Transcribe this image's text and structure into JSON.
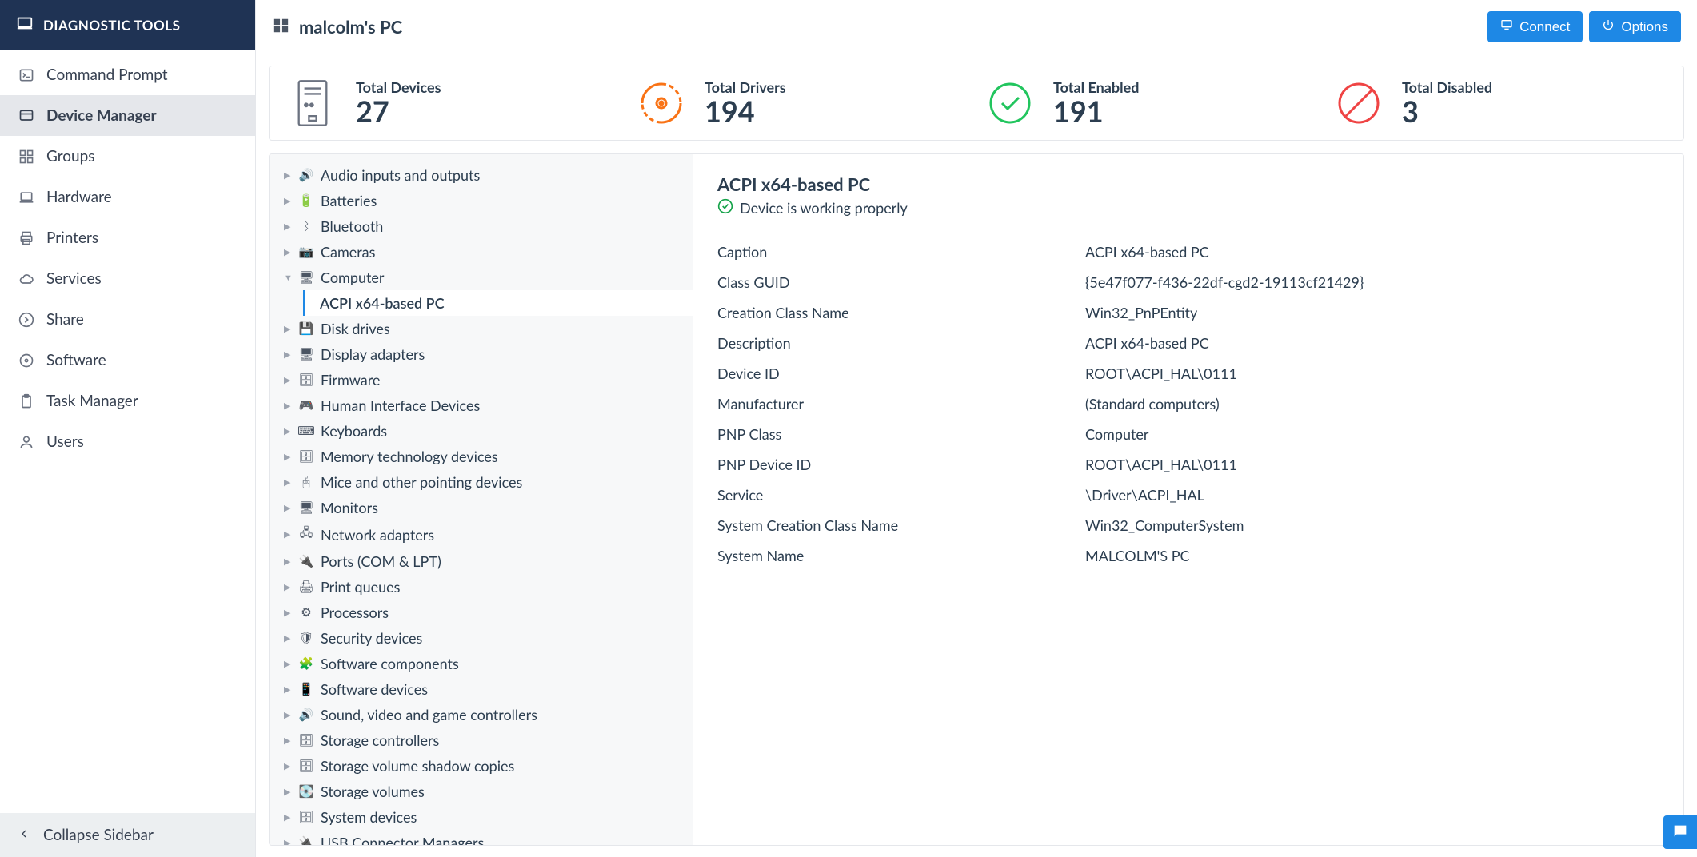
{
  "sidebar": {
    "title": "DIAGNOSTIC TOOLS",
    "items": [
      {
        "label": "Command Prompt",
        "icon": "terminal-icon"
      },
      {
        "label": "Device Manager",
        "icon": "device-icon",
        "active": true
      },
      {
        "label": "Groups",
        "icon": "grid-icon"
      },
      {
        "label": "Hardware",
        "icon": "laptop-icon"
      },
      {
        "label": "Printers",
        "icon": "printer-icon"
      },
      {
        "label": "Services",
        "icon": "cloud-icon"
      },
      {
        "label": "Share",
        "icon": "share-icon"
      },
      {
        "label": "Software",
        "icon": "disc-icon"
      },
      {
        "label": "Task Manager",
        "icon": "clipboard-icon"
      },
      {
        "label": "Users",
        "icon": "user-icon"
      }
    ],
    "collapse_label": "Collapse Sidebar"
  },
  "header": {
    "title": "malcolm's PC",
    "connect_label": "Connect",
    "options_label": "Options"
  },
  "stats": [
    {
      "label": "Total Devices",
      "value": "27",
      "icon": "tower-icon",
      "color": "#6b7280"
    },
    {
      "label": "Total Drivers",
      "value": "194",
      "icon": "cd-icon",
      "color": "#f97316"
    },
    {
      "label": "Total Enabled",
      "value": "191",
      "icon": "check-circle-icon",
      "color": "#22c55e"
    },
    {
      "label": "Total Disabled",
      "value": "3",
      "icon": "ban-icon",
      "color": "#ef4444"
    }
  ],
  "tree": [
    {
      "label": "Audio inputs and outputs",
      "icon": "🔊",
      "expanded": false
    },
    {
      "label": "Batteries",
      "icon": "🔋",
      "expanded": false
    },
    {
      "label": "Bluetooth",
      "icon": "ᛒ",
      "expanded": false
    },
    {
      "label": "Cameras",
      "icon": "📷",
      "expanded": false
    },
    {
      "label": "Computer",
      "icon": "🖥",
      "expanded": true,
      "children": [
        {
          "label": "ACPI x64-based PC",
          "selected": true
        }
      ]
    },
    {
      "label": "Disk drives",
      "icon": "💾",
      "expanded": false
    },
    {
      "label": "Display adapters",
      "icon": "🖥",
      "expanded": false
    },
    {
      "label": "Firmware",
      "icon": "🗄",
      "expanded": false
    },
    {
      "label": "Human Interface Devices",
      "icon": "🎮",
      "expanded": false
    },
    {
      "label": "Keyboards",
      "icon": "⌨",
      "expanded": false
    },
    {
      "label": "Memory technology devices",
      "icon": "🗄",
      "expanded": false
    },
    {
      "label": "Mice and other pointing devices",
      "icon": "🖱",
      "expanded": false
    },
    {
      "label": "Monitors",
      "icon": "🖥",
      "expanded": false
    },
    {
      "label": "Network adapters",
      "icon": "🖧",
      "expanded": false
    },
    {
      "label": "Ports (COM & LPT)",
      "icon": "🔌",
      "expanded": false
    },
    {
      "label": "Print queues",
      "icon": "🖨",
      "expanded": false
    },
    {
      "label": "Processors",
      "icon": "⚙",
      "expanded": false
    },
    {
      "label": "Security devices",
      "icon": "🛡",
      "expanded": false
    },
    {
      "label": "Software components",
      "icon": "🧩",
      "expanded": false
    },
    {
      "label": "Software devices",
      "icon": "📱",
      "expanded": false
    },
    {
      "label": "Sound, video and game controllers",
      "icon": "🔊",
      "expanded": false
    },
    {
      "label": "Storage controllers",
      "icon": "🗄",
      "expanded": false
    },
    {
      "label": "Storage volume shadow copies",
      "icon": "🗄",
      "expanded": false
    },
    {
      "label": "Storage volumes",
      "icon": "💽",
      "expanded": false
    },
    {
      "label": "System devices",
      "icon": "🗄",
      "expanded": false
    },
    {
      "label": "USB Connector Managers",
      "icon": "🔌",
      "expanded": false
    }
  ],
  "detail": {
    "title": "ACPI x64-based PC",
    "status": "Device is working properly",
    "properties": [
      {
        "label": "Caption",
        "value": "ACPI x64-based PC"
      },
      {
        "label": "Class GUID",
        "value": "{5e47f077-f436-22df-cgd2-19113cf21429}"
      },
      {
        "label": "Creation Class Name",
        "value": "Win32_PnPEntity"
      },
      {
        "label": "Description",
        "value": "ACPI x64-based PC"
      },
      {
        "label": "Device ID",
        "value": "ROOT\\ACPI_HAL\\0111"
      },
      {
        "label": "Manufacturer",
        "value": "(Standard computers)"
      },
      {
        "label": "PNP Class",
        "value": "Computer"
      },
      {
        "label": "PNP Device ID",
        "value": "ROOT\\ACPI_HAL\\0111"
      },
      {
        "label": "Service",
        "value": "\\Driver\\ACPI_HAL"
      },
      {
        "label": "System Creation Class Name",
        "value": "Win32_ComputerSystem"
      },
      {
        "label": "System Name",
        "value": "MALCOLM'S PC"
      }
    ]
  }
}
